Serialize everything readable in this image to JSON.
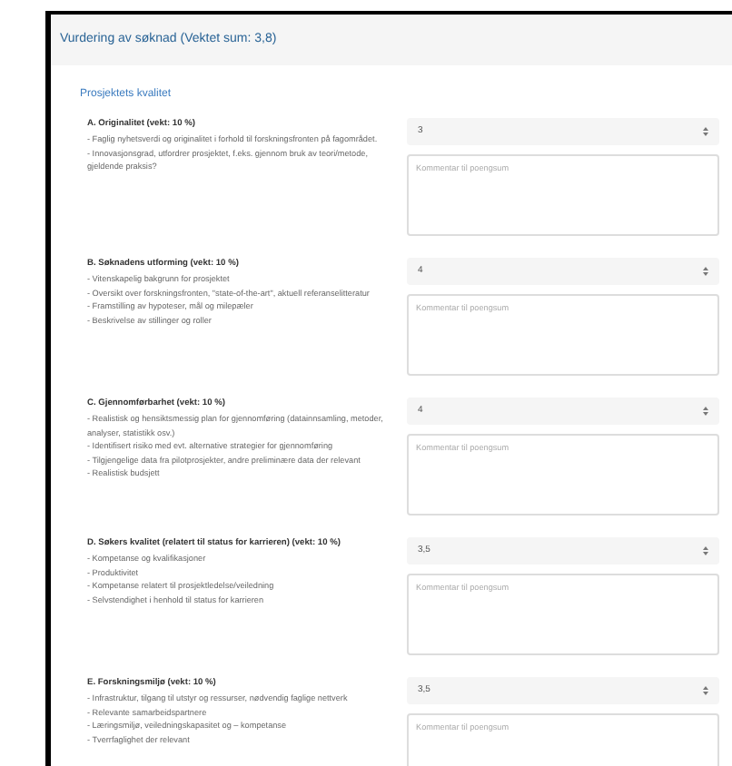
{
  "panel": {
    "title": "Vurdering av søknad (Vektet sum: 3,8)"
  },
  "section": {
    "title": "Prosjektets kvalitet"
  },
  "criteria": [
    {
      "title": "A. Originalitet (vekt: 10 %)",
      "lines": [
        "- Faglig nyhetsverdi og originalitet i forhold til forskningsfronten på fagområdet.",
        "- Innovasjonsgrad, utfordrer prosjektet, f.eks. gjennom bruk av teori/metode, gjeldende praksis?"
      ],
      "score": "3",
      "comment": {
        "placeholder": "Kommentar til poengsum"
      }
    },
    {
      "title": "B. Søknadens utforming (vekt: 10 %)",
      "lines": [
        "- Vitenskapelig bakgrunn for prosjektet",
        "- Oversikt over forskningsfronten, \"state-of-the-art\", aktuell referanselitteratur",
        "- Framstilling av hypoteser, mål og milepæler",
        "- Beskrivelse av stillinger og roller"
      ],
      "score": "4",
      "comment": {
        "placeholder": "Kommentar til poengsum"
      }
    },
    {
      "title": "C. Gjennomførbarhet (vekt: 10 %)",
      "lines": [
        "- Realistisk og hensiktsmessig plan for gjennomføring (datainnsamling, metoder, analyser, statistikk osv.)",
        "- Identifisert risiko med evt. alternative strategier for gjennomføring",
        "- Tilgjengelige data fra pilotprosjekter, andre preliminære data der relevant",
        "- Realistisk budsjett"
      ],
      "score": "4",
      "comment": {
        "placeholder": "Kommentar til poengsum"
      }
    },
    {
      "title": "D. Søkers kvalitet (relatert til status for karrieren) (vekt: 10 %)",
      "lines": [
        "- Kompetanse og kvalifikasjoner",
        "- Produktivitet",
        "- Kompetanse relatert til prosjektledelse/veiledning",
        "- Selvstendighet i henhold til status for karrieren"
      ],
      "score": "3,5",
      "comment": {
        "placeholder": "Kommentar til poengsum"
      }
    },
    {
      "title": "E. Forskningsmiljø (vekt: 10 %)",
      "lines": [
        "- Infrastruktur, tilgang til utstyr og ressurser, nødvendig faglige nettverk",
        "- Relevante samarbeidspartnere",
        "- Læringsmiljø, veiledningskapasitet og – kompetanse",
        "- Tverrfaglighet der relevant"
      ],
      "score": "3,5",
      "comment": {
        "placeholder": "Kommentar til poengsum"
      }
    }
  ]
}
